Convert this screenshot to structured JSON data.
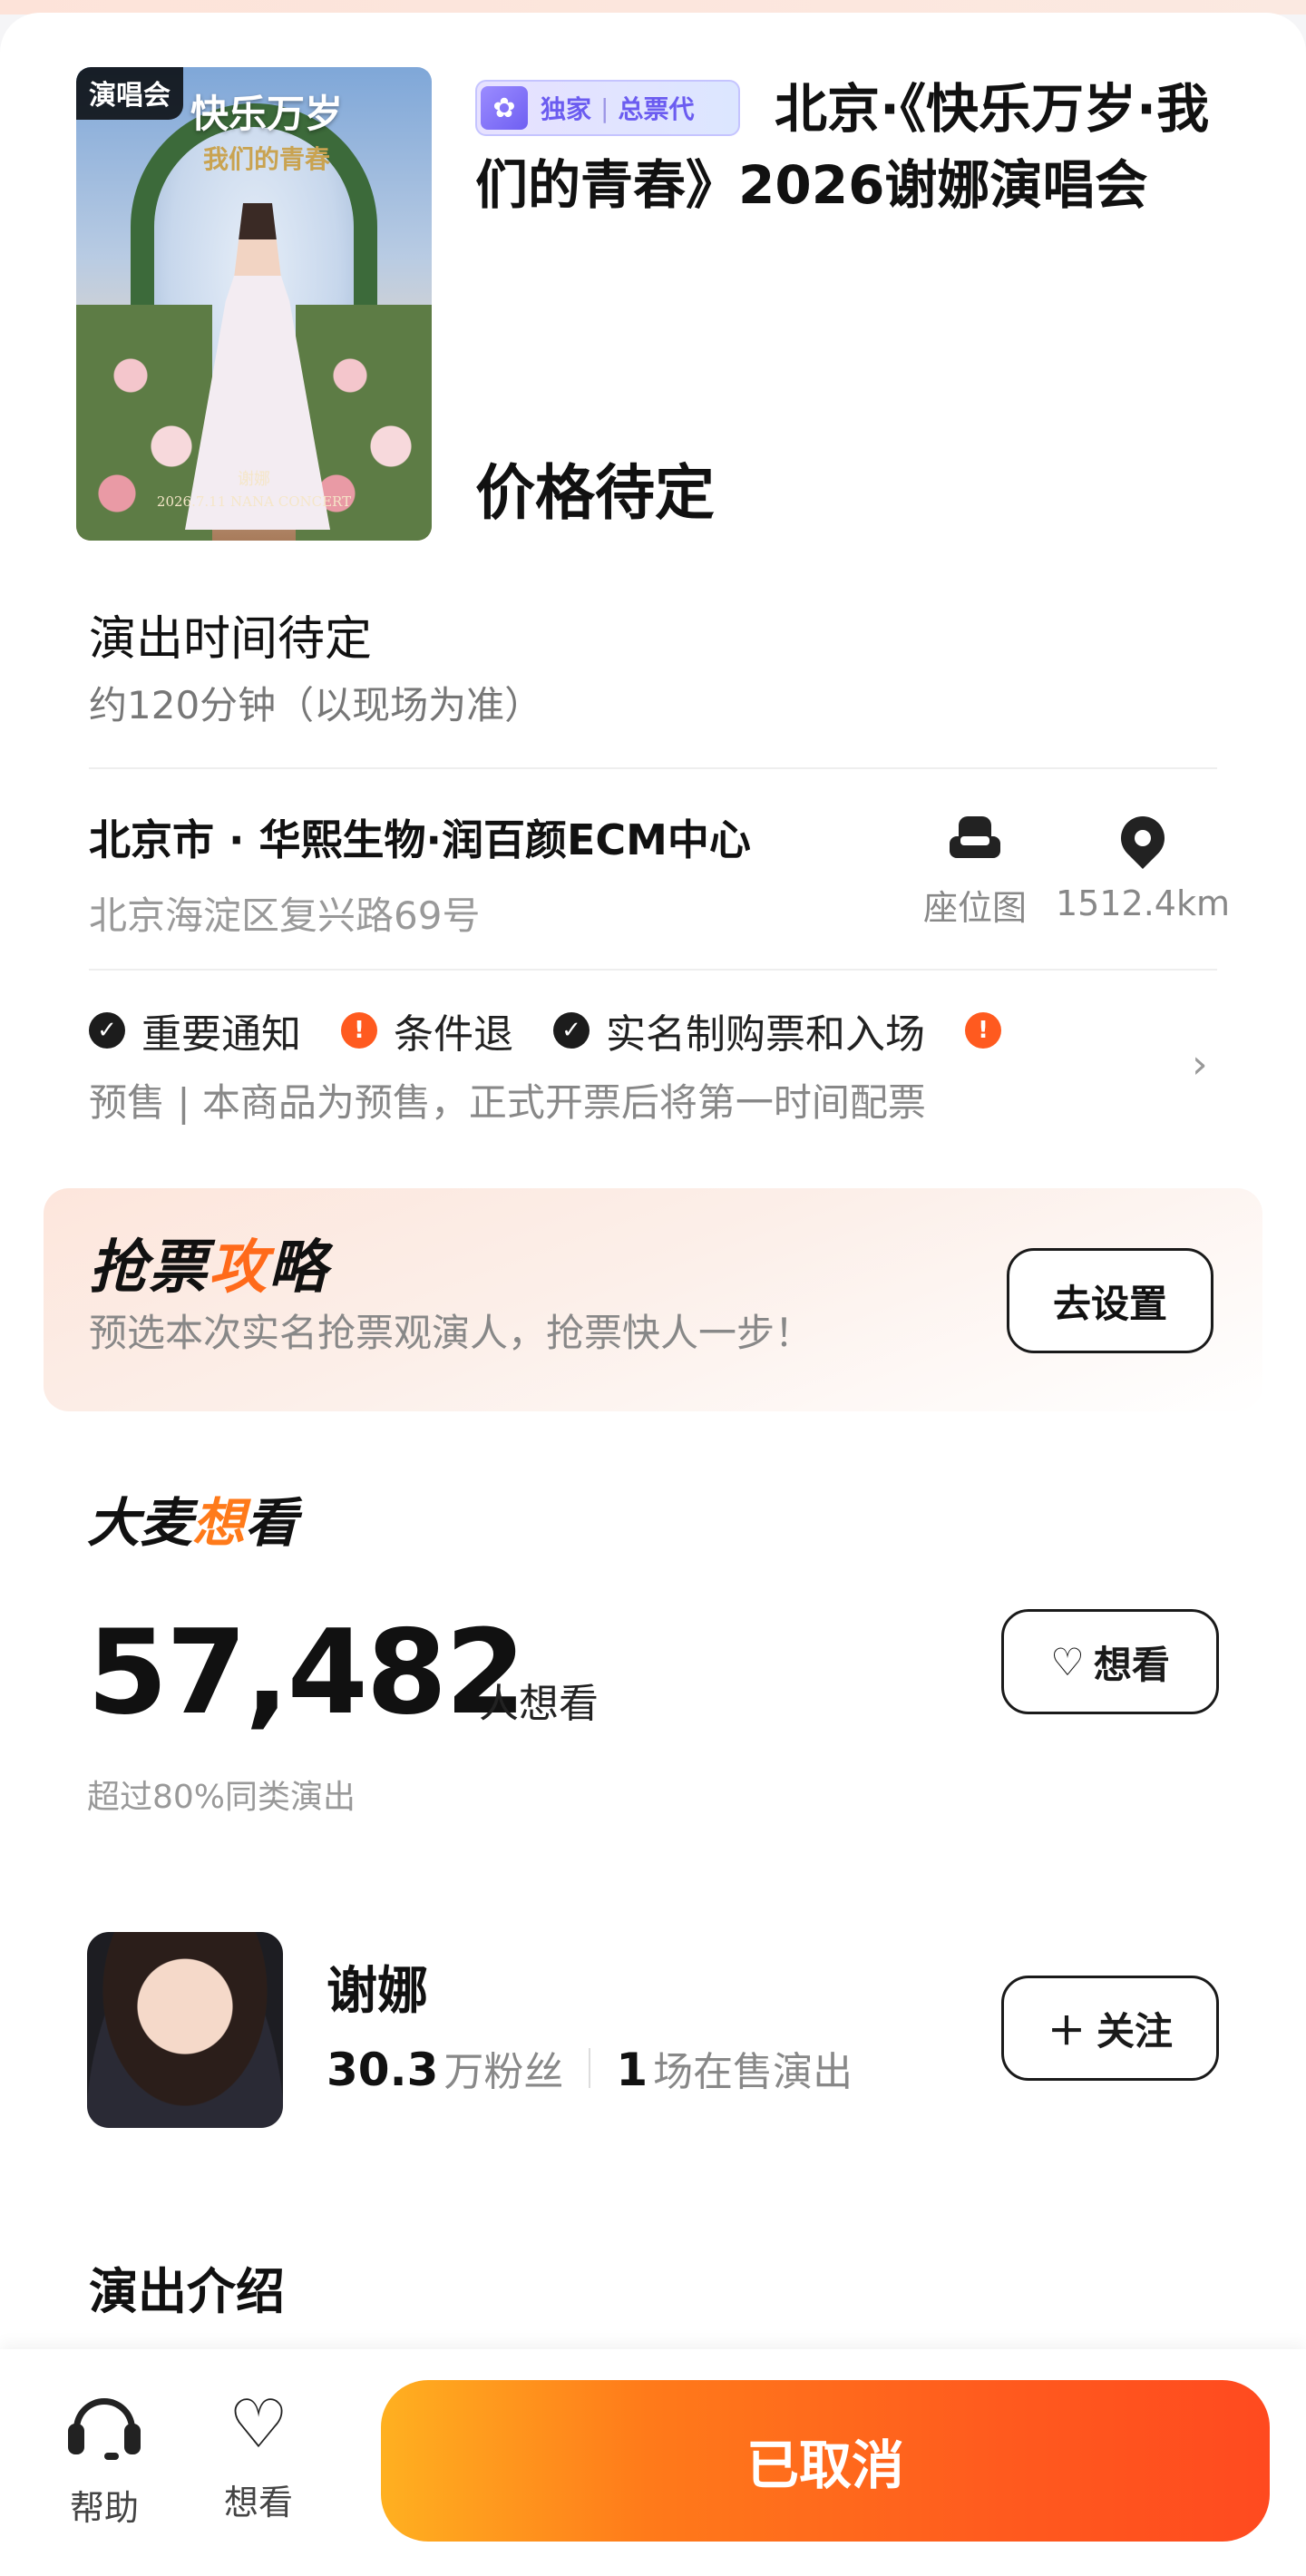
{
  "event": {
    "poster_tag": "演唱会",
    "poster_title": "快乐万岁",
    "poster_subtitle": "我们的青春",
    "poster_artist": "谢娜",
    "poster_date": "2026.7.11 NANA CONCERT",
    "badge_exclusive": "独家",
    "badge_agent": "总票代",
    "title": "北京·《快乐万岁·我们的青春》2026谢娜演唱会",
    "price": "价格待定"
  },
  "schedule": {
    "time": "演出时间待定",
    "duration": "约120分钟（以现场为准）"
  },
  "venue": {
    "name": "北京市 · 华熙生物·润百颜ECM中心",
    "address": "北京海淀区复兴路69号",
    "seat_map_label": "座位图",
    "distance": "1512.4km"
  },
  "notices": {
    "items": [
      {
        "label": "重要通知",
        "icon": "check-circle-icon"
      },
      {
        "label": "条件退",
        "icon": "warning-circle-icon"
      },
      {
        "label": "实名制购票和入场",
        "icon": "check-circle-icon"
      }
    ],
    "presale": "预售 | 本商品为预售，正式开票后将第一时间配票"
  },
  "guide": {
    "title_prefix": "抢票",
    "title_highlight": "攻",
    "title_suffix": "略",
    "subtitle": "预选本次实名抢票观演人，抢票快人一步！",
    "button": "去设置"
  },
  "want": {
    "logo_prefix": "大麦",
    "logo_highlight": "想",
    "logo_suffix": "看",
    "count": "57,482",
    "unit": "人想看",
    "note": "超过80%同类演出",
    "button": "想看"
  },
  "artist": {
    "name": "谢娜",
    "fans_value": "30.3",
    "fans_label": "万粉丝",
    "shows_value": "1",
    "shows_label": "场在售演出",
    "follow_button": "关注"
  },
  "intro": {
    "title": "演出介绍"
  },
  "bottom_bar": {
    "help_label": "帮助",
    "want_label": "想看",
    "primary_button": "已取消"
  },
  "colors": {
    "accent_orange": "#ff5a1f",
    "badge_purple": "#6b5cf0"
  }
}
